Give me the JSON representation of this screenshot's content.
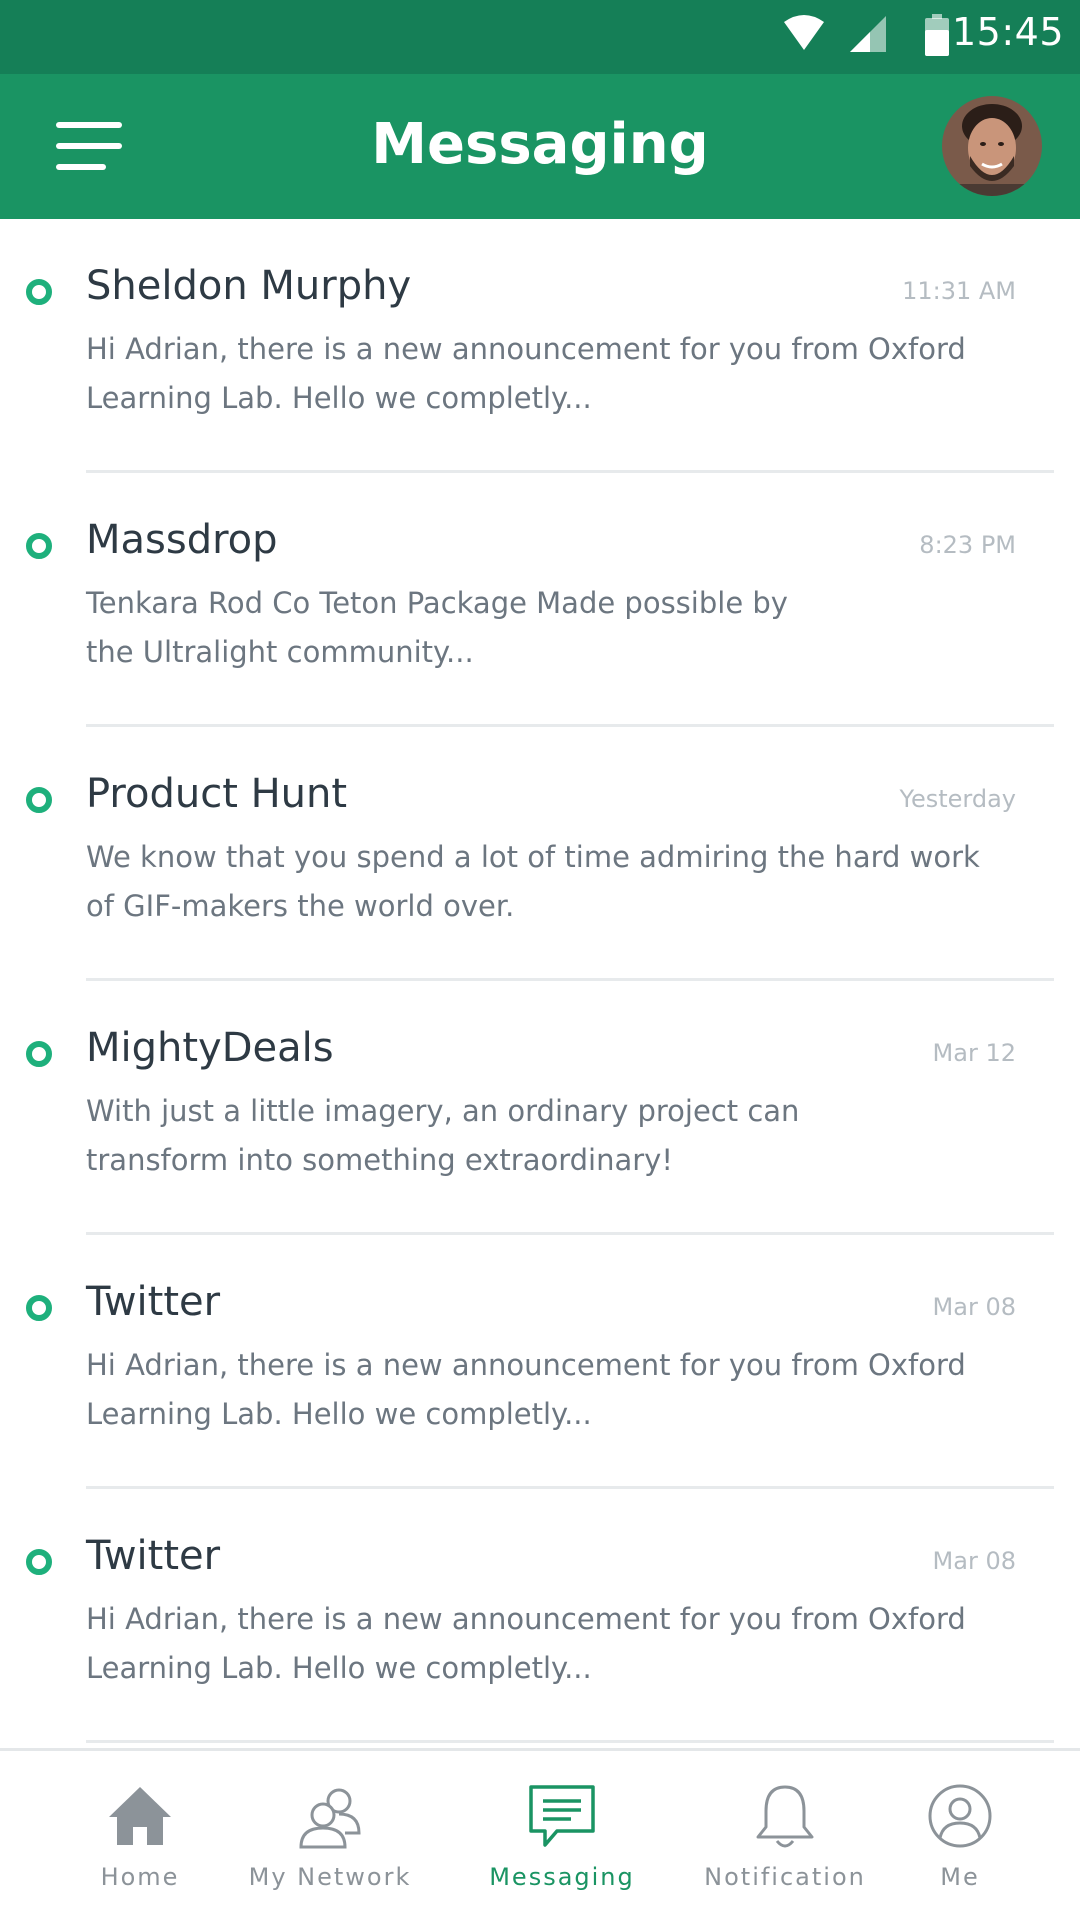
{
  "status_bar": {
    "time": "15:45",
    "icons": [
      "wifi-icon",
      "signal-icon",
      "battery-icon"
    ]
  },
  "app_bar": {
    "title": "Messaging",
    "menu_icon": "hamburger-menu-icon",
    "avatar": "user-avatar"
  },
  "messages": [
    {
      "sender": "Sheldon Murphy",
      "time": "11:31 AM",
      "preview": "Hi Adrian, there is a new announcement for you from Oxford Learning  Lab. Hello we completly...",
      "unread": true
    },
    {
      "sender": "Massdrop",
      "time": "8:23 PM",
      "preview": "Tenkara Rod Co Teton Package Made possible by the Ultralight community...",
      "unread": true
    },
    {
      "sender": "Product Hunt",
      "time": "Yesterday",
      "preview": "We know that you spend a lot of time admiring the hard work of GIF-makers the world over.",
      "unread": true
    },
    {
      "sender": "MightyDeals",
      "time": "Mar 12",
      "preview": "With just a little imagery, an ordinary project can transform into something extraordinary!",
      "unread": true
    },
    {
      "sender": "Twitter",
      "time": "Mar 08",
      "preview": "Hi Adrian, there is a new announcement for you from Oxford Learning  Lab. Hello we completly...",
      "unread": true
    },
    {
      "sender": "Twitter",
      "time": "Mar 08",
      "preview": "Hi Adrian, there is a new announcement for you from Oxford Learning  Lab. Hello we completly...",
      "unread": true
    }
  ],
  "bottom_nav": {
    "items": [
      {
        "label": "Home",
        "icon": "home-icon",
        "active": false
      },
      {
        "label": "My Network",
        "icon": "network-icon",
        "active": false
      },
      {
        "label": "Messaging",
        "icon": "message-icon",
        "active": true
      },
      {
        "label": "Notification",
        "icon": "bell-icon",
        "active": false
      },
      {
        "label": "Me",
        "icon": "profile-icon",
        "active": false
      }
    ]
  },
  "colors": {
    "status_bar": "#157F57",
    "app_bar": "#1A9463",
    "accent": "#1EB07C",
    "inactive": "#8C9399"
  }
}
